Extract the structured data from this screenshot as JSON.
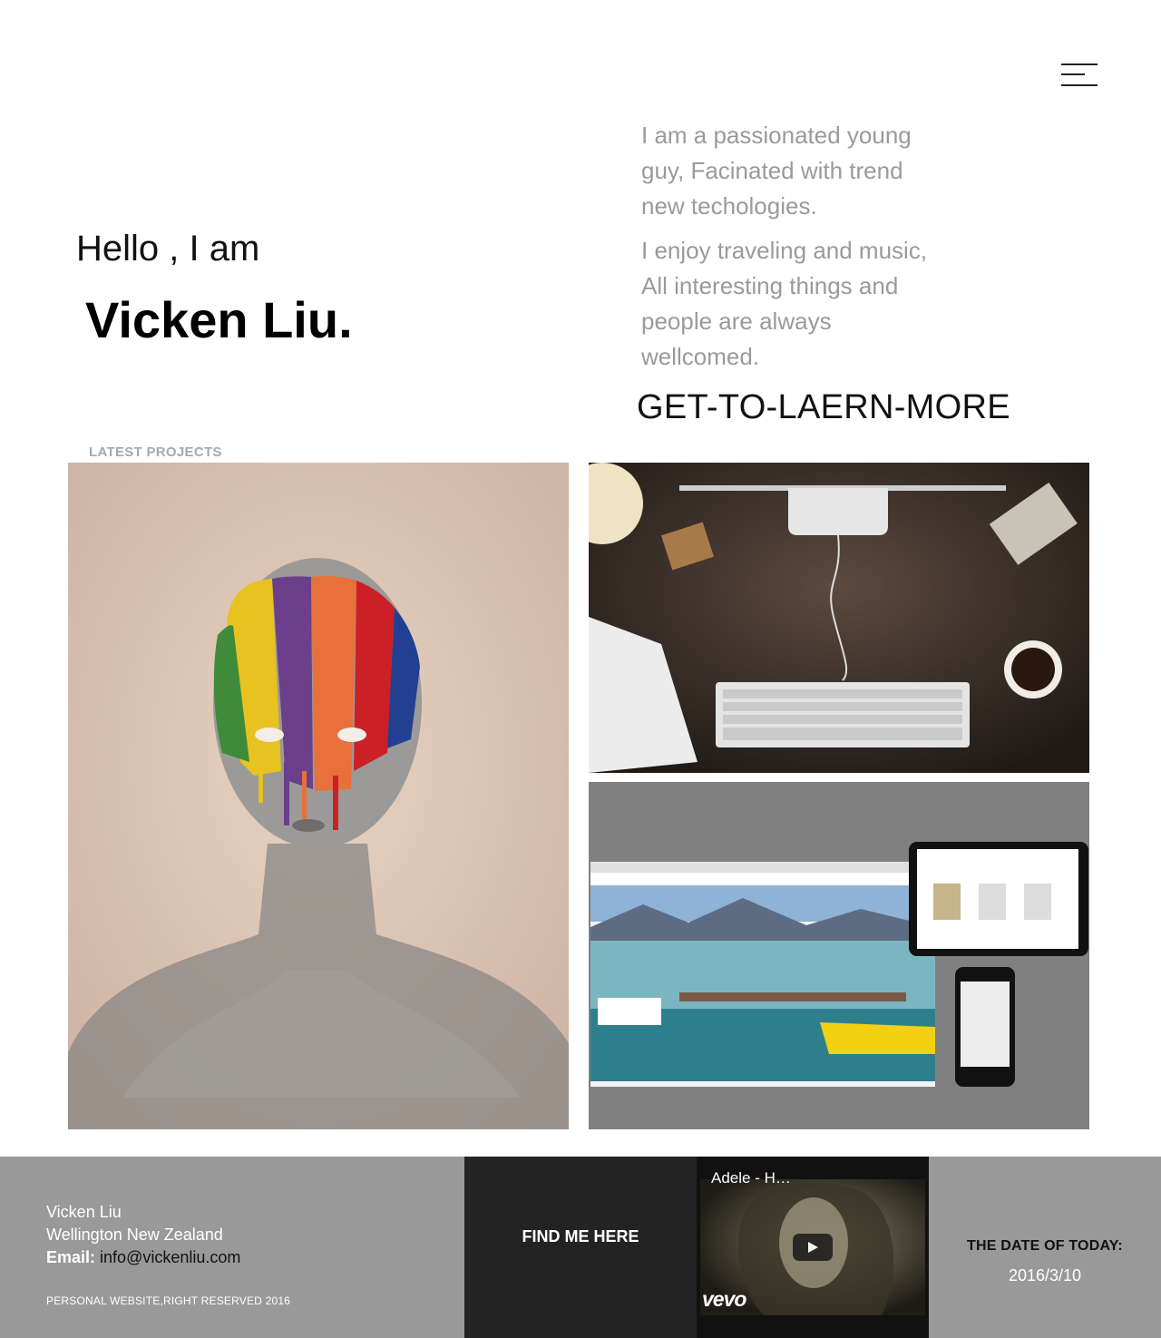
{
  "header": {
    "menu_icon": "hamburger-menu-icon"
  },
  "hero": {
    "greeting": "Hello , I am",
    "name": "Vicken Liu.",
    "intro_1": "I am a passionated young guy, Facinated with trend new techologies.",
    "intro_2": "I enjoy traveling and music, All interesting things and people are always wellcomed.",
    "cta_label": "GET-TO-LAERN-MORE"
  },
  "projects": {
    "heading": "LATEST PROJECTS"
  },
  "footer": {
    "contact_name": "Vicken Liu",
    "contact_location": "Wellington New Zealand",
    "email_label": "Email:",
    "email_value": "info@vickenliu.com",
    "copyright": "PERSONAL WEBSITE,RIGHT RESERVED 2016",
    "find_me_label": "FIND ME HERE",
    "video_title": "Adele - H…",
    "video_brand": "vevo",
    "date_label": "THE DATE OF TODAY:",
    "date_value": "2016/3/10"
  }
}
